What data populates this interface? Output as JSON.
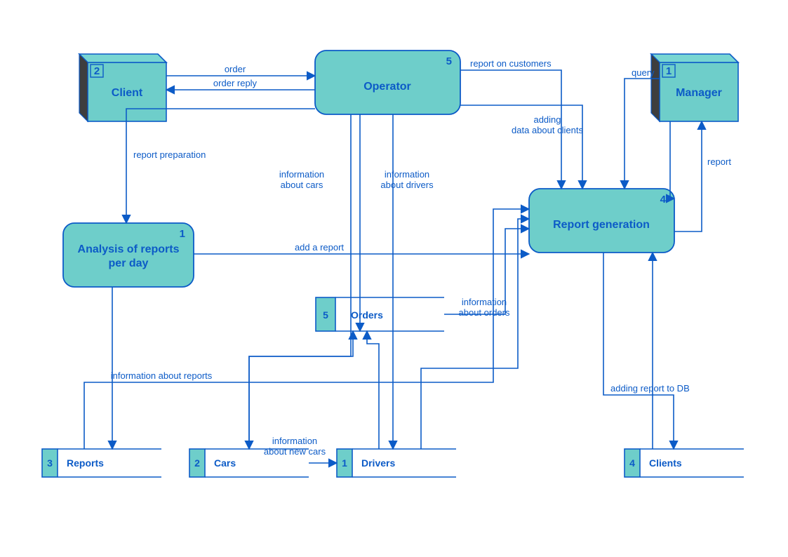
{
  "externals": {
    "client": {
      "num": "2",
      "label": "Client"
    },
    "manager": {
      "num": "1",
      "label": "Manager"
    }
  },
  "processes": {
    "operator": {
      "num": "5",
      "label": "Operator"
    },
    "reportgen": {
      "num": "4",
      "label": "Report generation"
    },
    "analysis": {
      "num": "1",
      "label": "Analysis of reports",
      "label2": "per day"
    }
  },
  "datastores": {
    "reports": {
      "num": "3",
      "label": "Reports"
    },
    "cars": {
      "num": "2",
      "label": "Cars"
    },
    "drivers": {
      "num": "1",
      "label": "Drivers"
    },
    "clients": {
      "num": "4",
      "label": "Clients"
    },
    "orders": {
      "num": "5",
      "label": "Orders"
    }
  },
  "flows": {
    "order": "order",
    "order_reply": "order reply",
    "report_on_customers": "report on customers",
    "adding_data_about_clients1": "adding",
    "adding_data_about_clients2": "data about clients",
    "query": "query",
    "report": "report",
    "report_preparation": "report preparation",
    "info_cars1": "information",
    "info_cars2": "about cars",
    "info_drivers1": "information",
    "info_drivers2": "about drivers",
    "add_a_report": "add a report",
    "info_orders1": "information",
    "info_orders2": "about orders",
    "info_about_reports": "information about reports",
    "adding_report_db": "adding report to DB",
    "info_new_cars1": "information",
    "info_new_cars2": "about new cars"
  }
}
